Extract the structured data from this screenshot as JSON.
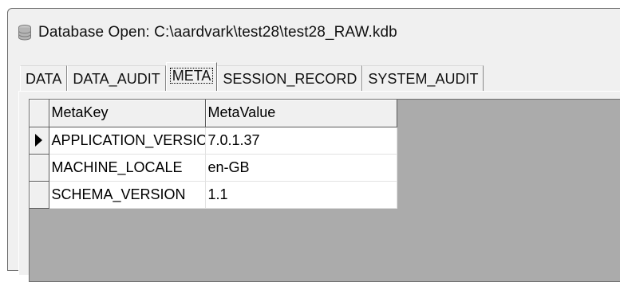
{
  "window": {
    "title": "Database Open: C:\\aardvark\\test28\\test28_RAW.kdb",
    "icon": "database-icon"
  },
  "tabs": [
    {
      "label": "DATA",
      "active": false
    },
    {
      "label": "DATA_AUDIT",
      "active": false
    },
    {
      "label": "META",
      "active": true
    },
    {
      "label": "SESSION_RECORD",
      "active": false
    },
    {
      "label": "SYSTEM_AUDIT",
      "active": false
    }
  ],
  "grid": {
    "columns": [
      "MetaKey",
      "MetaValue"
    ],
    "rows": [
      {
        "key": "APPLICATION_VERSION",
        "value": "7.0.1.37",
        "current": true
      },
      {
        "key": "MACHINE_LOCALE",
        "value": "en-GB",
        "current": false
      },
      {
        "key": "SCHEMA_VERSION",
        "value": "1.1",
        "current": false
      }
    ]
  },
  "colors": {
    "window_bg": "#f0f0f0",
    "grid_bg": "#ababab",
    "cell_bg": "#ffffff"
  }
}
